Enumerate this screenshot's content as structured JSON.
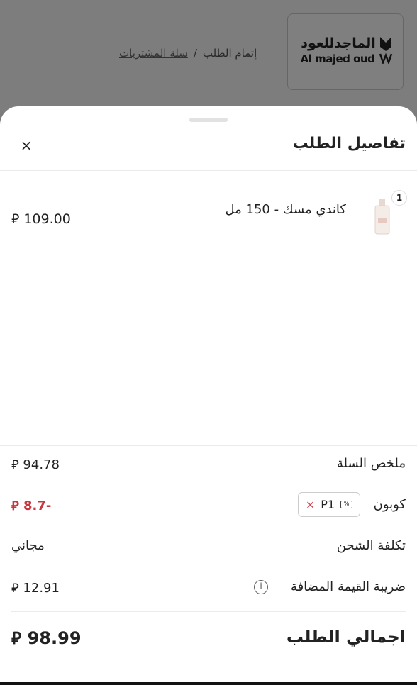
{
  "header": {
    "logo_ar": "الماجدللعود",
    "logo_en": "Al majed oud",
    "breadcrumb": {
      "cart": "سلة المشتريات",
      "separator": "/",
      "checkout": "إتمام الطلب"
    }
  },
  "sheet": {
    "title": "تفاصيل الطلب",
    "close_icon": "×"
  },
  "item": {
    "quantity": "1",
    "name": "كاندي مسك - 150 مل",
    "price": "⃁ 109.00"
  },
  "summary": {
    "cart_label": "ملخص السلة",
    "cart_value": "⃁ 94.78",
    "coupon_label": "كوبون",
    "coupon_code": "P1",
    "coupon_remove": "×",
    "coupon_value": "⃁ 8.7-",
    "shipping_label": "تكلفة الشحن",
    "shipping_value": "مجاني",
    "vat_label": "ضريبة القيمة المضافة",
    "vat_value": "⃁ 12.91",
    "total_label": "اجمالي الطلب",
    "total_value": "⃁ 98.99"
  },
  "colors": {
    "discount": "#c8373f",
    "overlay": "#7b7b7b"
  }
}
